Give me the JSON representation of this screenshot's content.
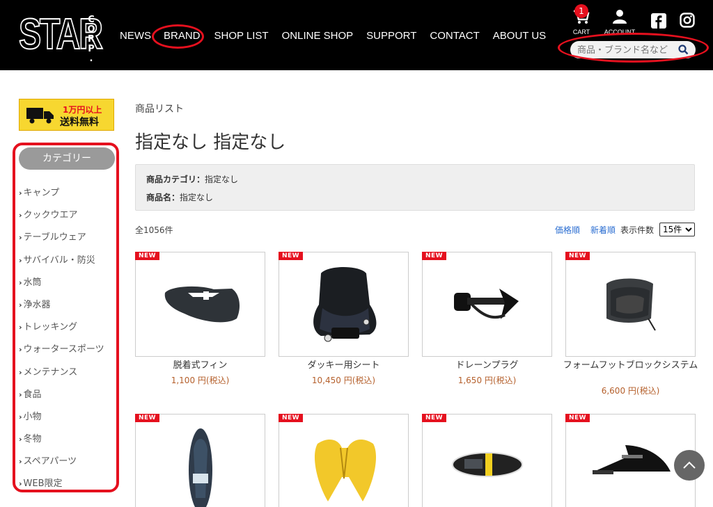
{
  "header": {
    "logo_main": "STAR",
    "logo_corp": [
      "C",
      "O",
      "R",
      "P",
      "."
    ],
    "nav": [
      "NEWS",
      "BRAND",
      "SHOP LIST",
      "ONLINE SHOP",
      "SUPPORT",
      "CONTACT",
      "ABOUT US"
    ],
    "cart_label": "CART",
    "cart_count": "1",
    "account_label": "ACCOUNT",
    "search_placeholder": "商品・ブランド名など"
  },
  "sidebar": {
    "banner_line1": "1万円以上",
    "banner_line2": "送料無料",
    "category_title": "カテゴリー",
    "categories": [
      "キャンプ",
      "クックウエア",
      "テーブルウェア",
      "サバイバル・防災",
      "水筒",
      "浄水器",
      "トレッキング",
      "ウォータースポーツ",
      "メンテナンス",
      "食品",
      "小物",
      "冬物",
      "スペアパーツ",
      "WEB限定"
    ]
  },
  "main": {
    "breadcrumb": "商品リスト",
    "title": "指定なし 指定なし",
    "filter": {
      "category_label": "商品カテゴリ：",
      "category_value": "指定なし",
      "name_label": "商品名：",
      "name_value": "指定なし"
    },
    "count": "全1056件",
    "sort_price": "価格順",
    "sort_new": "新着順",
    "per_page_label": "表示件数",
    "per_page_value": "15件",
    "new_badge": "NEW",
    "products": [
      {
        "name": "脱着式フィン",
        "price": "1,100 円(税込)"
      },
      {
        "name": "ダッキー用シート",
        "price": "10,450 円(税込)"
      },
      {
        "name": "ドレーンプラグ",
        "price": "1,650 円(税込)"
      },
      {
        "name": "フォームフットブロックシステム",
        "price": "6,600 円(税込)"
      },
      {
        "name": "",
        "price": ""
      },
      {
        "name": "",
        "price": ""
      },
      {
        "name": "",
        "price": ""
      },
      {
        "name": "",
        "price": ""
      }
    ]
  },
  "colors": {
    "header_bg": "#000000",
    "highlight_red": "#e5101e",
    "price": "#b5602c",
    "link": "#2d6fd2",
    "banner_yellow": "#f7d730"
  }
}
